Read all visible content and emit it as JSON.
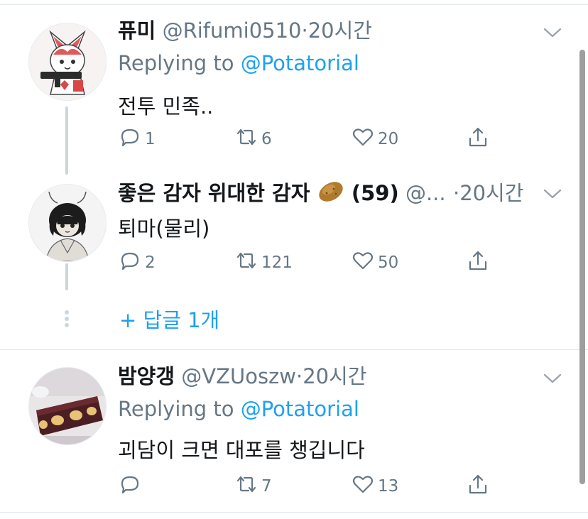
{
  "tweets": [
    {
      "name": "퓨미",
      "handle": "@Rifumi0510",
      "dot": "·",
      "time": "20시간",
      "reply_label": "Replying to",
      "reply_mention": "@Potatorial",
      "text": "전투 민족..",
      "replies": "1",
      "retweets": "6",
      "likes": "20"
    },
    {
      "name": "좋은 감자 위대한 감자",
      "name_suffix": "(59)",
      "handle": "@...",
      "dot": "·",
      "time": "20시간",
      "text": "퇴마(물리)",
      "replies": "2",
      "retweets": "121",
      "likes": "50"
    },
    {
      "name": "밤양갱",
      "handle": "@VZUoszw",
      "dot": "·",
      "time": "20시간",
      "reply_label": "Replying to",
      "reply_mention": "@Potatorial",
      "text": "괴담이 크면 대포를 챙깁니다",
      "replies": "",
      "retweets": "7",
      "likes": "13"
    }
  ],
  "thread": {
    "more_replies": "+ 답글 1개"
  },
  "icons": {
    "reply": "reply-icon",
    "retweet": "retweet-icon",
    "like": "heart-icon",
    "share": "share-icon",
    "menu": "chevron-down-icon",
    "emoji": "potato-emoji"
  },
  "colors": {
    "accent": "#1da1f2",
    "secondary": "#657786",
    "divider": "#e1e8ed"
  }
}
